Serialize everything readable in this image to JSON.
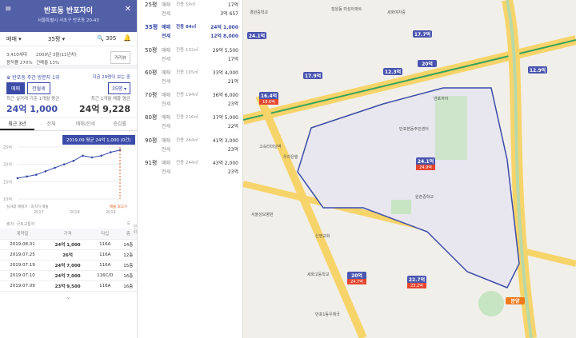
{
  "header": {
    "title": "반포동 반포자이",
    "address": "서울특별시 서초구 반포동 20-43"
  },
  "selector": {
    "deal": "매매",
    "size": "35평",
    "photo": "305"
  },
  "info": {
    "units": "3,410세대",
    "date": "2009년 3월(11년차)",
    "far": "용적률 270%",
    "bcr": "건폐율 13%",
    "btn": "거리뷰"
  },
  "visit": {
    "label": "반포동 주간 방문자 1위",
    "right": "지금 29명이 보는 중",
    "tab1": "매매",
    "tab2": "전월세",
    "dd": "35평",
    "l1": "최근 실거래 기준 1개월 평균",
    "l2": "최근 1개월 매물 평균",
    "v1": "24억 1,000",
    "v2": "24억 9,228"
  },
  "chart_tabs": [
    "최근 3년",
    "전체",
    "매매/전세",
    "증감률"
  ],
  "chart": {
    "tooltip": "2019.09 평균 24억 1,000 (0건)",
    "legend": "실거래 매매가 · 최저가 매물",
    "legend2": "매물 최고가",
    "xticks": [
      "2017",
      "2018",
      "2019"
    ],
    "yticks": [
      "25억",
      "20억",
      "15억",
      "10억"
    ]
  },
  "chart_data": {
    "type": "line",
    "x": [
      "2017.01",
      "2017.04",
      "2017.07",
      "2017.10",
      "2018.01",
      "2018.04",
      "2018.07",
      "2018.10",
      "2019.01",
      "2019.04",
      "2019.07",
      "2019.09"
    ],
    "values": [
      16,
      16.5,
      17,
      18,
      19,
      20,
      21,
      22.5,
      22,
      22.5,
      23.5,
      24.1
    ],
    "ylim": [
      10,
      25
    ]
  },
  "table": {
    "source": "출처: 국토교통부",
    "unit": "단위",
    "headers": [
      "계약일",
      "가격",
      "타입",
      "층"
    ],
    "rows": [
      [
        "2019.08.01",
        "24억 1,000",
        "116A",
        "14층"
      ],
      [
        "2019.07.25",
        "26억",
        "116A",
        "12층"
      ],
      [
        "2019.07.19",
        "24억 7,000",
        "116A",
        "15층"
      ],
      [
        "2019.07.10",
        "24억 7,000",
        "116C/D",
        "16층"
      ],
      [
        "2019.07.09",
        "23억 9,500",
        "116A",
        "16층"
      ]
    ]
  },
  "prices": [
    {
      "py": "25평",
      "area": "전용 59㎡",
      "s": "17억",
      "j": "3억 657"
    },
    {
      "py": "35평",
      "area": "전용 84㎡",
      "s": "24억 1,000",
      "j": "12억 8,000",
      "hl": true
    },
    {
      "py": "50평",
      "area": "전용 132㎡",
      "s": "29억 5,500",
      "j": "17억"
    },
    {
      "py": "60평",
      "area": "전용 165㎡",
      "s": "33억 4,000",
      "j": "21억"
    },
    {
      "py": "70평",
      "area": "전용 194㎡",
      "s": "36억 6,000",
      "j": "23억"
    },
    {
      "py": "80평",
      "area": "전용 216㎡",
      "s": "37억 5,000",
      "j": "22억"
    },
    {
      "py": "90평",
      "area": "전용 244㎡",
      "s": "41억 3,000",
      "j": "23억"
    },
    {
      "py": "91평",
      "area": "전용 244㎡",
      "s": "43억 2,000",
      "j": "23억"
    }
  ],
  "labels": {
    "sale": "매매",
    "rent": "전세"
  },
  "map_markers": [
    {
      "v": "24.1억",
      "s": ""
    },
    {
      "v": "16.4억",
      "s": "18.6억"
    },
    {
      "v": "17.9억",
      "s": ""
    },
    {
      "v": "12.3억",
      "s": ""
    },
    {
      "v": "17.7억",
      "s": ""
    },
    {
      "v": "20억",
      "s": ""
    },
    {
      "v": "24.1억",
      "s": "24.9억"
    },
    {
      "v": "20억",
      "s": "24.7억"
    },
    {
      "v": "22.7억",
      "s": "23.2억"
    },
    {
      "v": "12.9억",
      "s": ""
    },
    {
      "v": "분양",
      "s": ""
    }
  ],
  "map_labels": [
    "경원중학교",
    "잠원동 미성아파트",
    "세화여자중",
    "반포본동주민센터",
    "고속터미널역",
    "서울성모병원",
    "우리은행",
    "원촌중학교",
    "신영교회",
    "세화고등학교",
    "반포1동우체국",
    "반포자이"
  ]
}
